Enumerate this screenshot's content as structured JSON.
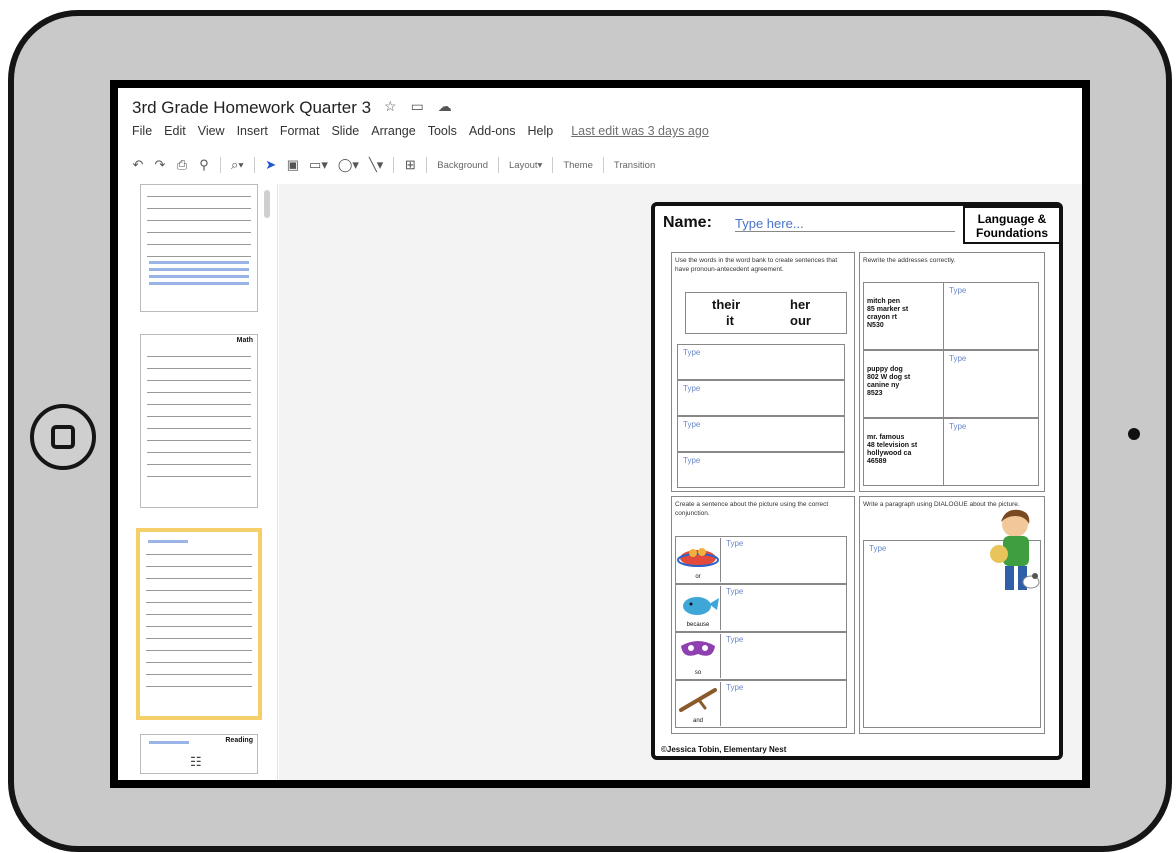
{
  "app": {
    "title": "3rd Grade Homework Quarter 3",
    "title_icons": [
      "star-icon",
      "folder-icon",
      "cloud-icon"
    ],
    "menu": [
      "File",
      "Edit",
      "View",
      "Insert",
      "Format",
      "Slide",
      "Arrange",
      "Tools",
      "Add-ons",
      "Help"
    ],
    "last_edit": "Last edit was 3 days ago"
  },
  "toolbar": {
    "icons": [
      "undo-icon",
      "redo-icon",
      "print-icon",
      "paint-format-icon",
      "zoom-icon",
      "select-icon",
      "text-box-icon",
      "image-icon",
      "shape-icon",
      "line-icon",
      "comment-icon"
    ],
    "background": "Background",
    "layout": "Layout",
    "theme": "Theme",
    "transition": "Transition"
  },
  "filmstrip": {
    "thumbs": [
      {
        "label": ""
      },
      {
        "label": "Math"
      },
      {
        "label": ""
      },
      {
        "label": "Reading"
      }
    ],
    "selected_index": 2
  },
  "worksheet": {
    "name_label": "Name:",
    "name_value": "Type here...",
    "subject": [
      "Language &",
      "Foundations"
    ],
    "q1_instructions": "Use the words in the word bank to create sentences that have pronoun-antecedent agreement.",
    "word_bank": [
      "their",
      "her",
      "it",
      "our"
    ],
    "q1_answers": [
      "Type",
      "Type",
      "Type",
      "Type"
    ],
    "q2_instructions": "Rewrite the addresses correctly.",
    "addresses": [
      {
        "lines": [
          "mitch pen",
          "85 marker st",
          "crayon rt",
          "N530"
        ],
        "answer": "Type"
      },
      {
        "lines": [
          "puppy dog",
          "802 W dog st",
          "canine ny",
          "8523"
        ],
        "answer": "Type"
      },
      {
        "lines": [
          "mr. famous",
          "48 television st",
          "hollywood ca",
          "46589"
        ],
        "answer": "Type"
      }
    ],
    "q3_instructions": "Create a sentence about the picture using the correct conjunction.",
    "conjunctions": [
      {
        "word": "or",
        "answer": "Type"
      },
      {
        "word": "because",
        "answer": "Type"
      },
      {
        "word": "so",
        "answer": "Type"
      },
      {
        "word": "and",
        "answer": "Type"
      }
    ],
    "q4_instructions": "Write a paragraph using DIALOGUE about the picture.",
    "q4_answer": "Type",
    "copyright": "©Jessica Tobin, Elementary Nest"
  },
  "colors": {
    "accent_blue": "#4a73c9",
    "selected_thumb": "#f4cf6a",
    "frame": "#c9c9c9"
  }
}
